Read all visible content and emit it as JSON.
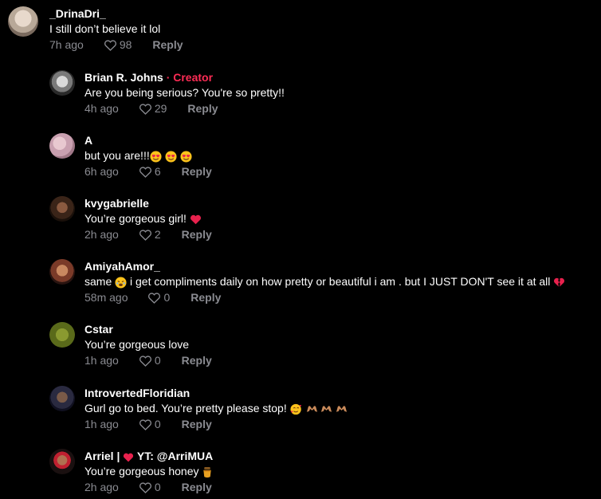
{
  "comments": [
    {
      "name": "_DrinaDri_",
      "creator_tag": "",
      "text": "I still don’t believe it lol",
      "time": "7h ago",
      "likes": "98",
      "reply": "Reply"
    },
    {
      "name": "Brian R. Johns",
      "creator_tag": "· Creator",
      "text": "Are you being serious? You're so pretty!!",
      "time": "4h ago",
      "likes": "29",
      "reply": "Reply"
    },
    {
      "name": "A",
      "creator_tag": "",
      "text": "but you are!!!",
      "time": "6h ago",
      "likes": "6",
      "reply": "Reply"
    },
    {
      "name": "kvygabrielle",
      "creator_tag": "",
      "text": "You’re gorgeous girl!",
      "time": "2h ago",
      "likes": "2",
      "reply": "Reply"
    },
    {
      "name": "AmiyahAmor_",
      "creator_tag": "",
      "text_a": "same",
      "text_b": "i get compliments daily on how pretty or beautiful i am . but I JUST DON'T see it at all",
      "time": "58m ago",
      "likes": "0",
      "reply": "Reply"
    },
    {
      "name": "Cstar",
      "creator_tag": "",
      "text": "You’re gorgeous love",
      "time": "1h ago",
      "likes": "0",
      "reply": "Reply"
    },
    {
      "name": "IntrovertedFloridian",
      "creator_tag": "",
      "text": "Gurl go to bed. You’re pretty please stop!",
      "time": "1h ago",
      "likes": "0",
      "reply": "Reply"
    },
    {
      "name_a": "Arriel |",
      "name_b": "YT: @ArriMUA",
      "creator_tag": "",
      "text": "You’re gorgeous honey",
      "time": "2h ago",
      "likes": "0",
      "reply": "Reply"
    }
  ],
  "colors": {
    "background": "#000000",
    "meta": "#8a8b91",
    "creator": "#fe2c55"
  },
  "icons": [
    "heart-outline-icon",
    "smiling-face-heart-eyes-emoji",
    "red-heart-emoji",
    "weary-face-emoji",
    "broken-heart-emoji",
    "smiling-face-with-hearts-emoji",
    "heart-hands-emoji",
    "honey-pot-emoji"
  ]
}
